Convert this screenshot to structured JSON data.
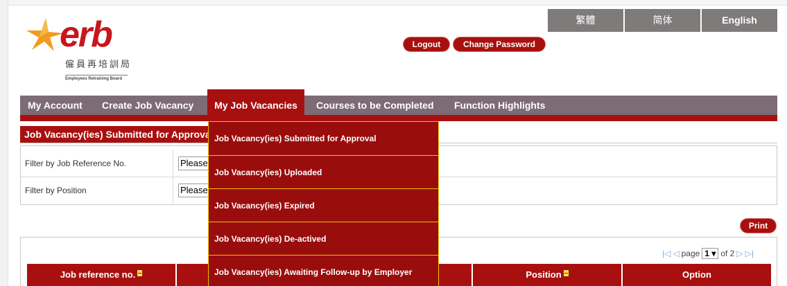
{
  "brand": {
    "logo_text": "erb",
    "logo_cn": "僱員再培訓局",
    "logo_en": "Employees Retraining Board"
  },
  "languages": [
    "繁體",
    "简体",
    "English"
  ],
  "account_links": {
    "logout": "Logout",
    "change_password": "Change Password"
  },
  "nav": {
    "items": [
      "My Account",
      "Create Job Vacancy",
      "My Job Vacancies",
      "Courses to be Completed",
      "Function Highlights"
    ],
    "active": "My Job Vacancies"
  },
  "dropdown": {
    "items": [
      "Job Vacancy(ies) Submitted for Approval",
      "Job Vacancy(ies) Uploaded",
      "Job Vacancy(ies) Expired",
      "Job Vacancy(ies) De-actived",
      "Job Vacancy(ies) Awaiting Follow-up by Employer"
    ]
  },
  "section": {
    "title": "Job Vacancy(ies) Submitted for Approval"
  },
  "filters": {
    "ref_label": "Filter by Job Reference No.",
    "ref_value": "Please select",
    "position_label": "Filter by Position",
    "position_value": "Please select"
  },
  "toolbar": {
    "print": "Print"
  },
  "pager": {
    "page_label": "page",
    "page_value": "1",
    "of_label": "of 2"
  },
  "table": {
    "headers": [
      "Job reference no.",
      "",
      "",
      "Position",
      "Option"
    ]
  },
  "colors": {
    "brand_red": "#a8100f",
    "nav_bg": "#7d6b75",
    "lang_bg": "#7f7b7b",
    "dropdown_border": "#f0c000"
  }
}
